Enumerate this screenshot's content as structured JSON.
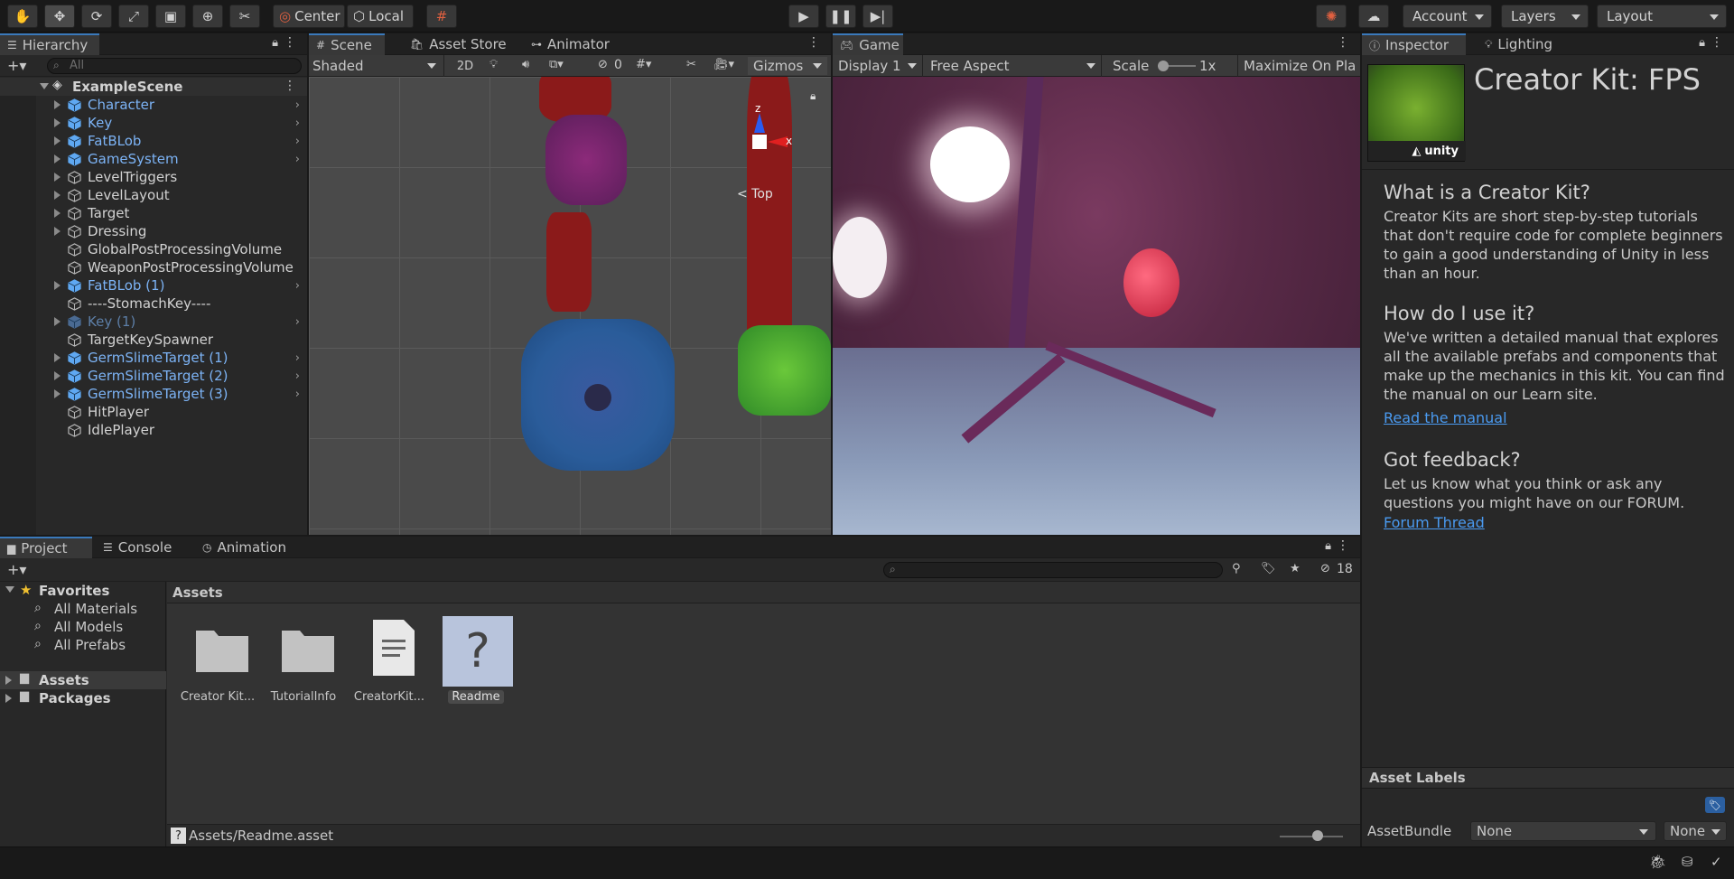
{
  "toolbar": {
    "tools": [
      "hand-tool-icon",
      "move-tool-icon",
      "rotate-tool-icon",
      "scale-tool-icon",
      "rect-tool-icon",
      "transform-tool-icon",
      "custom-tool-icon"
    ],
    "pivot": "Center",
    "space": "Local",
    "account": "Account",
    "layers": "Layers",
    "layout": "Layout"
  },
  "hierarchy": {
    "tab": "Hierarchy",
    "search_placeholder": "All",
    "scene": "ExampleScene",
    "items": [
      {
        "label": "Character",
        "style": "blue",
        "arrow": true,
        "chev": true
      },
      {
        "label": "Key",
        "style": "blue",
        "arrow": true,
        "chev": true
      },
      {
        "label": "FatBLob",
        "style": "blue",
        "arrow": true,
        "chev": true
      },
      {
        "label": "GameSystem",
        "style": "blue",
        "arrow": true,
        "chev": true
      },
      {
        "label": "LevelTriggers",
        "style": "white",
        "arrow": true,
        "chev": false
      },
      {
        "label": "LevelLayout",
        "style": "white",
        "arrow": true,
        "chev": false
      },
      {
        "label": "Target",
        "style": "white",
        "arrow": true,
        "chev": false
      },
      {
        "label": "Dressing",
        "style": "white",
        "arrow": true,
        "chev": false
      },
      {
        "label": "GlobalPostProcessingVolume",
        "style": "white",
        "arrow": false,
        "chev": false
      },
      {
        "label": "WeaponPostProcessingVolume",
        "style": "white",
        "arrow": false,
        "chev": false
      },
      {
        "label": "FatBLob (1)",
        "style": "blue",
        "arrow": true,
        "chev": true
      },
      {
        "label": "----StomachKey----",
        "style": "white",
        "arrow": false,
        "chev": false
      },
      {
        "label": "Key (1)",
        "style": "faded",
        "arrow": true,
        "chev": true
      },
      {
        "label": "TargetKeySpawner",
        "style": "white",
        "arrow": false,
        "chev": false
      },
      {
        "label": "GermSlimeTarget (1)",
        "style": "blue",
        "arrow": true,
        "chev": true
      },
      {
        "label": "GermSlimeTarget (2)",
        "style": "blue",
        "arrow": true,
        "chev": true
      },
      {
        "label": "GermSlimeTarget (3)",
        "style": "blue",
        "arrow": true,
        "chev": true
      },
      {
        "label": "HitPlayer",
        "style": "white",
        "arrow": false,
        "chev": false
      },
      {
        "label": "IdlePlayer",
        "style": "white",
        "arrow": false,
        "chev": false
      }
    ]
  },
  "scene": {
    "tabs": [
      "Scene",
      "Asset Store",
      "Animator"
    ],
    "shading": "Shaded",
    "mode2d": "2D",
    "hidden_count": "0",
    "gizmos": "Gizmos",
    "axis_z": "z",
    "axis_x": "x",
    "view_label": "< Top"
  },
  "game": {
    "tab": "Game",
    "display": "Display 1",
    "aspect": "Free Aspect",
    "scale_label": "Scale",
    "scale_value": "1x",
    "maximize": "Maximize On Pla"
  },
  "inspector": {
    "tabs": [
      "Inspector",
      "Lighting"
    ],
    "logo_text": "unity",
    "title": "Creator Kit: FPS",
    "h1": "What is a Creator Kit?",
    "p1": "Creator Kits are short step-by-step tutorials that don't require code for complete beginners to gain a good understanding of Unity in less than an hour.",
    "h2": "How do I use it?",
    "p2": "We've written a detailed manual that explores all the available prefabs and components that make up the mechanics in this kit. You can find the manual on our Learn site.",
    "link1": "Read the manual",
    "h3": "Got feedback?",
    "p3": "Let us know what you think or ask any questions you might have on our FORUM.",
    "link2": "Forum Thread",
    "asset_labels": "Asset Labels",
    "assetbundle_label": "AssetBundle",
    "assetbundle_value": "None",
    "variant_value": "None"
  },
  "project": {
    "tabs": [
      "Project",
      "Console",
      "Animation"
    ],
    "hidden_count": "18",
    "favorites": "Favorites",
    "fav_items": [
      "All Materials",
      "All Models",
      "All Prefabs"
    ],
    "tree": [
      "Assets",
      "Packages"
    ],
    "breadcrumb": "Assets",
    "assets": [
      {
        "label": "Creator Kit...",
        "kind": "folder"
      },
      {
        "label": "TutorialInfo",
        "kind": "folder"
      },
      {
        "label": "CreatorKit...",
        "kind": "doc"
      },
      {
        "label": "Readme",
        "kind": "unknown"
      }
    ],
    "path": "Assets/Readme.asset"
  }
}
